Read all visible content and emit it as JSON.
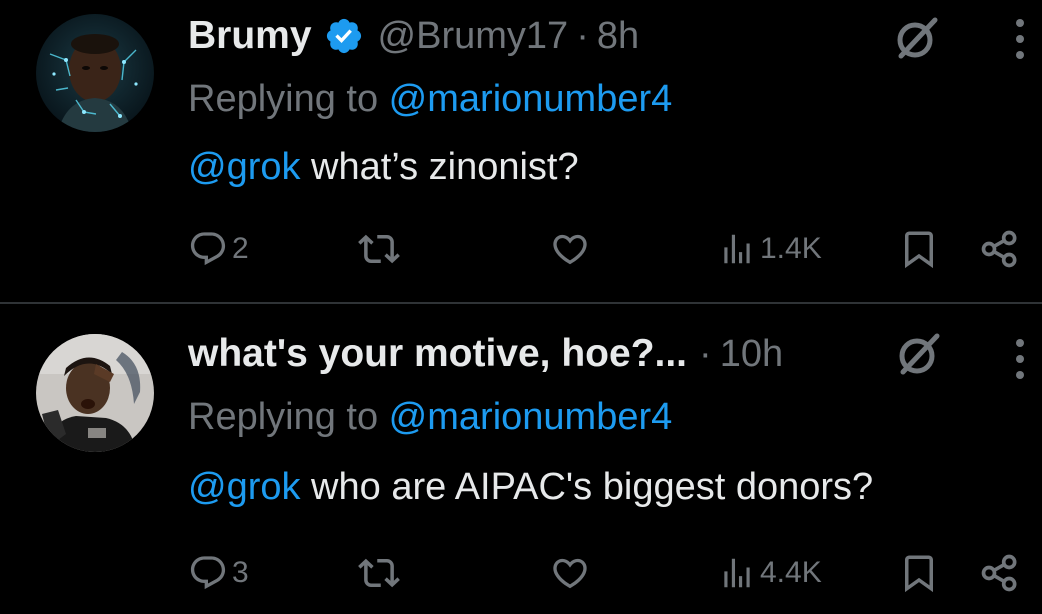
{
  "colors": {
    "background": "#000000",
    "text": "#e7e9ea",
    "muted": "#71767b",
    "link": "#1d9bf0",
    "divider": "#2f3336"
  },
  "tweets": [
    {
      "display_name": "Brumy",
      "verified": true,
      "handle": "@Brumy17",
      "separator": "·",
      "time": "8h",
      "reply_prefix": "Replying to ",
      "reply_to": "@marionumber4",
      "mention": "@grok",
      "text": " what’s zinonist?",
      "replies": "2",
      "retweets": "",
      "likes": "",
      "views": "1.4K",
      "icons": [
        "grok-icon",
        "more-icon",
        "reply-icon",
        "retweet-icon",
        "like-icon",
        "views-icon",
        "bookmark-icon",
        "share-icon"
      ]
    },
    {
      "display_name": "what's your motive, hoe?...",
      "verified": false,
      "handle": "",
      "separator": "·",
      "time": "10h",
      "reply_prefix": "Replying to ",
      "reply_to": "@marionumber4",
      "mention": "@grok",
      "text": " who are AIPAC's biggest donors?",
      "replies": "3",
      "retweets": "",
      "likes": "",
      "views": "4.4K",
      "icons": [
        "grok-icon",
        "more-icon",
        "reply-icon",
        "retweet-icon",
        "like-icon",
        "views-icon",
        "bookmark-icon",
        "share-icon"
      ]
    }
  ]
}
